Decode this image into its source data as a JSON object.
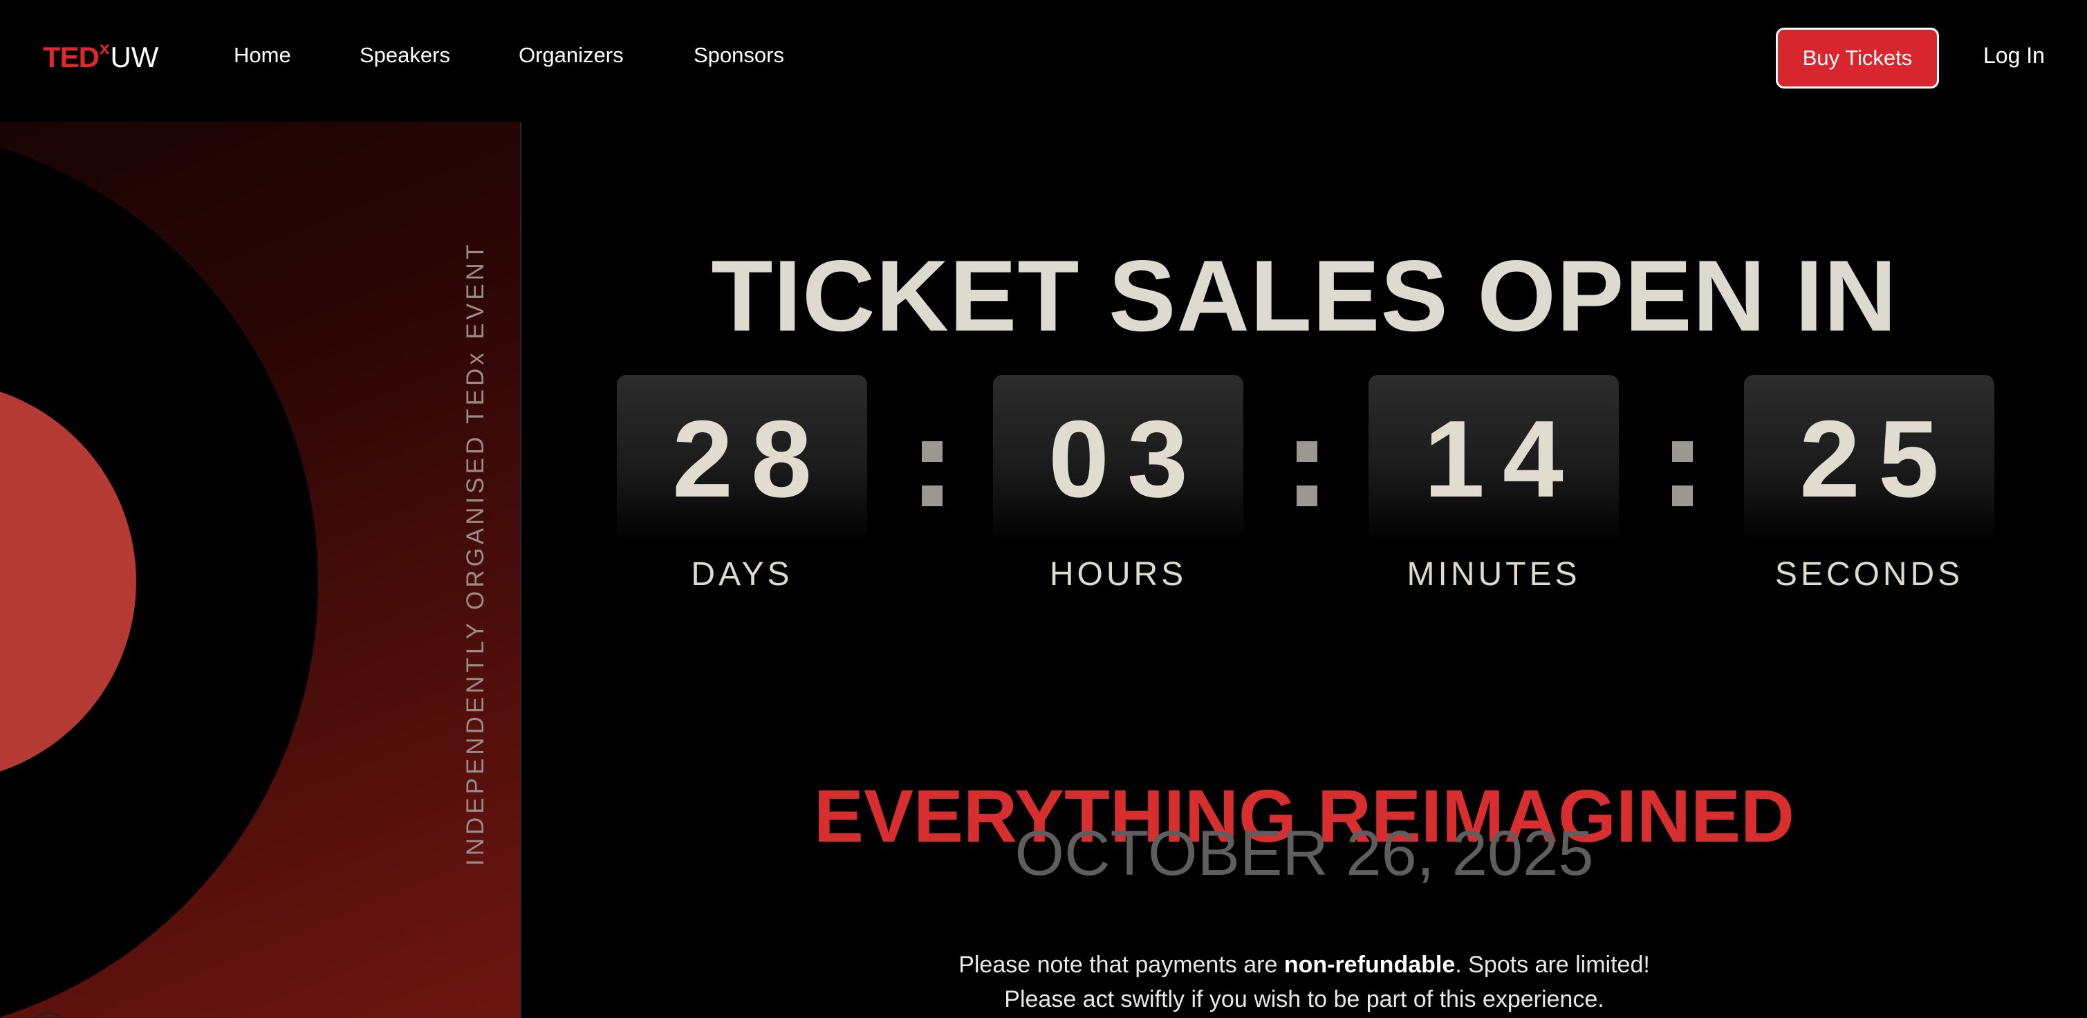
{
  "nav": {
    "logo": {
      "ted": "TED",
      "x": "x",
      "uw": "UW"
    },
    "links": [
      "Home",
      "Speakers",
      "Organizers",
      "Sponsors"
    ],
    "buy_tickets": "Buy Tickets",
    "login": "Log In"
  },
  "side_panel": {
    "vertical_text": "INDEPENDENTLY ORGANISED TEDx EVENT"
  },
  "main": {
    "headline": "TICKET SALES OPEN IN",
    "countdown": [
      {
        "value": "28",
        "label": "DAYS"
      },
      {
        "value": "03",
        "label": "HOURS"
      },
      {
        "value": "14",
        "label": "MINUTES"
      },
      {
        "value": "25",
        "label": "SECONDS"
      }
    ],
    "separator": ":",
    "tagline": "EVERYTHING REIMAGINED",
    "event_date": "OCTOBER 26, 2025",
    "note": {
      "line1_before": "Please note that payments are ",
      "line1_bold": "non-refundable",
      "line1_after": ". Spots are limited!",
      "line2": "Please act swiftly if you wish to be part of this experience."
    }
  },
  "colors": {
    "background": "#000000",
    "brand_red": "#d7262d",
    "headline": "#dddad0",
    "muted_date": "#5e5e5e"
  }
}
